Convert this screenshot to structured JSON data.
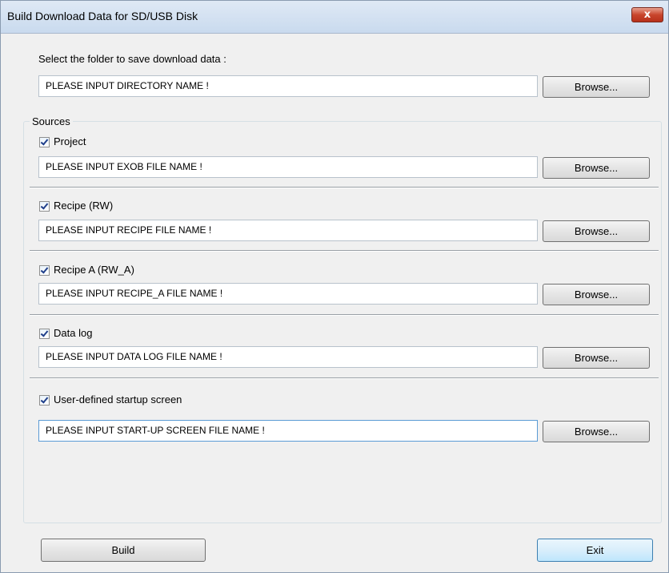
{
  "window": {
    "title": "Build Download Data for SD/USB Disk",
    "close_label": "x"
  },
  "folder": {
    "label": "Select the folder to save download data :",
    "value": "PLEASE INPUT DIRECTORY NAME !",
    "browse": "Browse..."
  },
  "sources": {
    "legend": "Sources",
    "items": [
      {
        "label": "Project",
        "checked": true,
        "value": "PLEASE INPUT EXOB FILE NAME !",
        "browse": "Browse..."
      },
      {
        "label": "Recipe (RW)",
        "checked": true,
        "value": "PLEASE INPUT RECIPE FILE NAME !",
        "browse": "Browse..."
      },
      {
        "label": "Recipe A (RW_A)",
        "checked": true,
        "value": "PLEASE INPUT RECIPE_A FILE NAME !",
        "browse": "Browse..."
      },
      {
        "label": "Data log",
        "checked": true,
        "value": "PLEASE INPUT DATA LOG FILE NAME !",
        "browse": "Browse..."
      },
      {
        "label": "User-defined startup screen",
        "checked": true,
        "value": "PLEASE INPUT START-UP SCREEN FILE NAME !",
        "browse": "Browse..."
      }
    ]
  },
  "footer": {
    "build_label": "Build",
    "exit_label": "Exit"
  }
}
